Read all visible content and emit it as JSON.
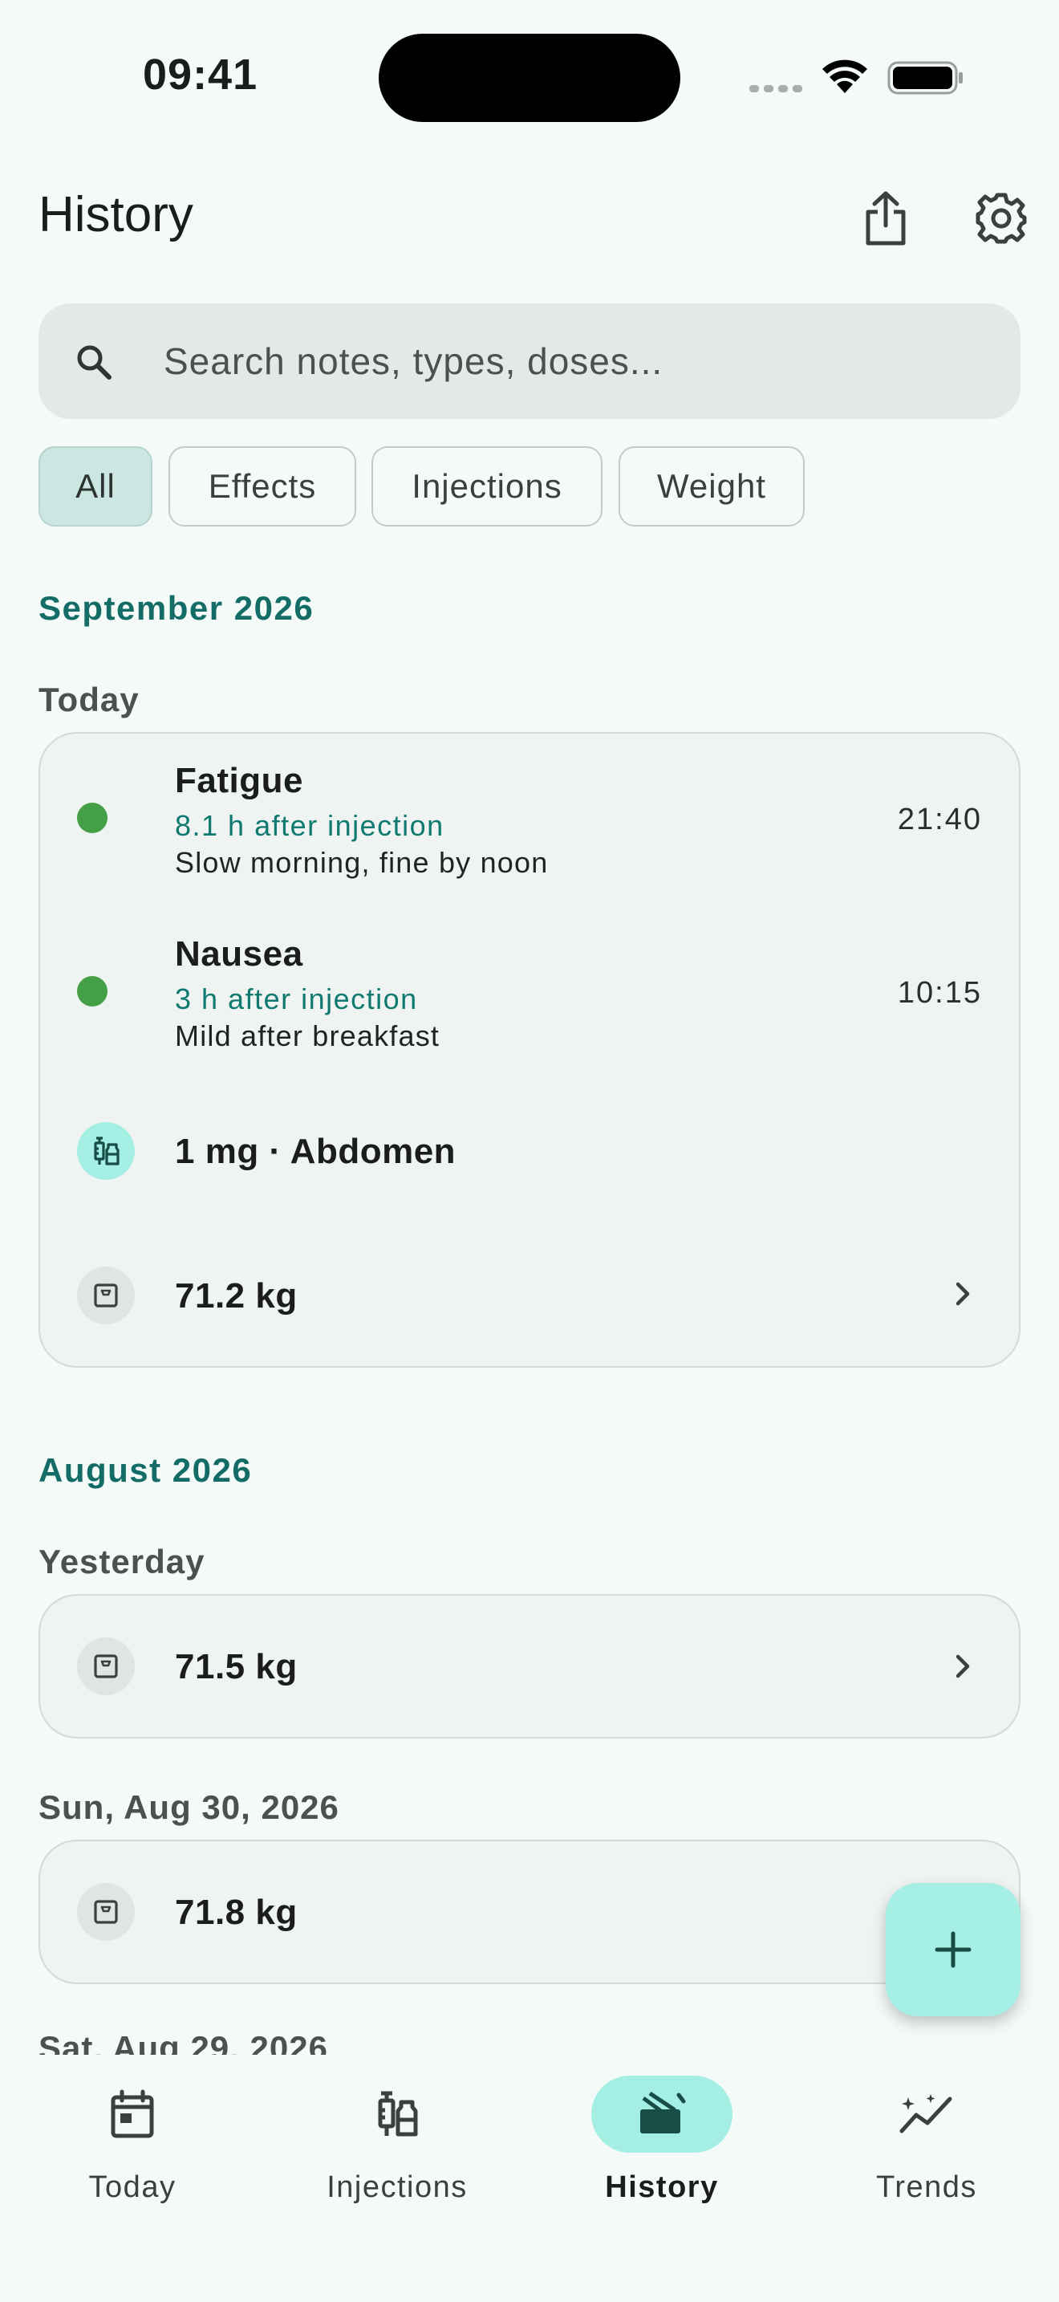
{
  "status_bar": {
    "time": "09:41"
  },
  "header": {
    "title": "History"
  },
  "search": {
    "placeholder": "Search notes, types, doses..."
  },
  "filters": [
    {
      "label": "All",
      "active": true
    },
    {
      "label": "Effects",
      "active": false
    },
    {
      "label": "Injections",
      "active": false
    },
    {
      "label": "Weight",
      "active": false
    }
  ],
  "sections": [
    {
      "month": "September 2026",
      "groups": [
        {
          "day": "Today",
          "entries": [
            {
              "kind": "effect",
              "title": "Fatigue",
              "subtitle": "8.1 h after injection",
              "note": "Slow morning, fine by noon",
              "time": "21:40",
              "color": "#43a047"
            },
            {
              "kind": "effect",
              "title": "Nausea",
              "subtitle": "3 h after injection",
              "note": "Mild after breakfast",
              "time": "10:15",
              "color": "#43a047"
            },
            {
              "kind": "injection",
              "value": "1 mg · Abdomen",
              "icon": "syringe-icon"
            },
            {
              "kind": "weight",
              "value": "71.2 kg",
              "icon": "scale-icon"
            }
          ]
        }
      ]
    },
    {
      "month": "August 2026",
      "groups": [
        {
          "day": "Yesterday",
          "entries": [
            {
              "kind": "weight",
              "value": "71.5 kg",
              "icon": "scale-icon"
            }
          ]
        },
        {
          "day": "Sun, Aug 30, 2026",
          "entries": [
            {
              "kind": "weight",
              "value": "71.8 kg",
              "icon": "scale-icon"
            }
          ]
        },
        {
          "day": "Sat, Aug 29, 2026",
          "entries": []
        }
      ]
    }
  ],
  "nav": [
    {
      "label": "Today",
      "icon": "calendar-icon",
      "active": false
    },
    {
      "label": "Injections",
      "icon": "syringe-icon",
      "active": false
    },
    {
      "label": "History",
      "icon": "history-icon",
      "active": true
    },
    {
      "label": "Trends",
      "icon": "trends-icon",
      "active": false
    }
  ],
  "colors": {
    "accent": "#136c66",
    "accent_container": "#a4eee4",
    "effect_dot": "#43a047"
  }
}
